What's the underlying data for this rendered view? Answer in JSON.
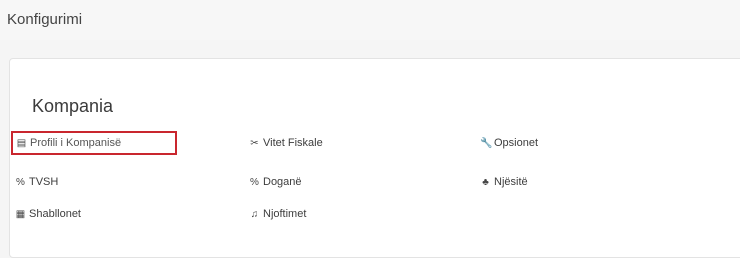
{
  "header": {
    "title": "Konfigurimi"
  },
  "panel": {
    "section_title": "Kompania",
    "items": [
      {
        "label": "Profili i Kompanisë",
        "icon": "document-icon",
        "glyph": "▤",
        "selected": true,
        "highlight_color": "#c9262e"
      },
      {
        "label": "Vitet Fiskale",
        "icon": "scissors-icon",
        "glyph": "✂"
      },
      {
        "label": "Opsionet",
        "icon": "wrench-icon",
        "glyph": "🔧"
      },
      {
        "label": "TVSH",
        "icon": "percent-icon",
        "glyph": "%"
      },
      {
        "label": "Doganë",
        "icon": "percent-icon",
        "glyph": "%"
      },
      {
        "label": "Njësitë",
        "icon": "sitemap-icon",
        "glyph": "♣"
      },
      {
        "label": "Shabllonet",
        "icon": "template-icon",
        "glyph": "▦"
      },
      {
        "label": "Njoftimet",
        "icon": "bell-icon",
        "glyph": "♫"
      }
    ]
  }
}
